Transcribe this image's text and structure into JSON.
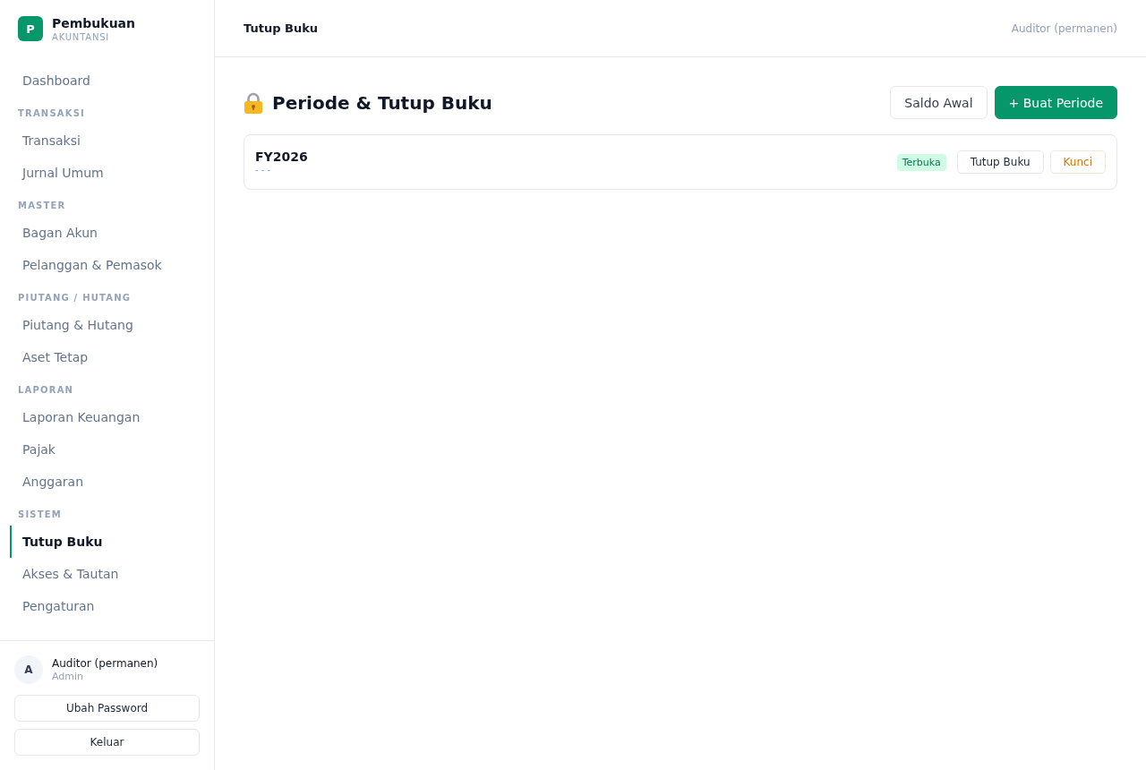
{
  "sidebar": {
    "brand": {
      "logo_letter": "P",
      "title": "Pembukuan",
      "subtitle": "AKUNTANSI"
    },
    "nav": [
      {
        "items": [
          {
            "label": "Dashboard",
            "selected": false
          }
        ]
      },
      {
        "title": "TRANSAKSI",
        "items": [
          {
            "label": "Transaksi",
            "selected": false
          },
          {
            "label": "Jurnal Umum",
            "selected": false
          }
        ]
      },
      {
        "title": "MASTER",
        "items": [
          {
            "label": "Bagan Akun",
            "selected": false
          },
          {
            "label": "Pelanggan & Pemasok",
            "selected": false
          }
        ]
      },
      {
        "title": "PIUTANG / HUTANG",
        "items": [
          {
            "label": "Piutang & Hutang",
            "selected": false
          },
          {
            "label": "Aset Tetap",
            "selected": false
          }
        ]
      },
      {
        "title": "LAPORAN",
        "items": [
          {
            "label": "Laporan Keuangan",
            "selected": false
          },
          {
            "label": "Pajak",
            "selected": false
          },
          {
            "label": "Anggaran",
            "selected": false
          }
        ]
      },
      {
        "title": "SISTEM",
        "items": [
          {
            "label": "Tutup Buku",
            "selected": true
          },
          {
            "label": "Akses & Tautan",
            "selected": false
          },
          {
            "label": "Pengaturan",
            "selected": false
          }
        ]
      }
    ],
    "user": {
      "avatar_letter": "A",
      "name": "Auditor (permanen)",
      "role": "Admin"
    },
    "buttons": [
      "Ubah Password",
      "Keluar"
    ]
  },
  "topbar": {
    "title": "Tutup Buku",
    "user": "Auditor (permanen)"
  },
  "page": {
    "title": "Periode & Tutup Buku",
    "actions": [
      {
        "kind": "secondary",
        "label": "Saldo Awal"
      },
      {
        "kind": "primary",
        "label": "+ Buat Periode"
      }
    ],
    "periods": [
      {
        "name": "FY2026",
        "dates": "- - -",
        "status": {
          "kind": "open",
          "label": "Terbuka"
        },
        "actions": [
          {
            "kind": "neutral",
            "label": "Tutup Buku"
          },
          {
            "kind": "warning",
            "label": "Kunci"
          }
        ]
      }
    ]
  }
}
